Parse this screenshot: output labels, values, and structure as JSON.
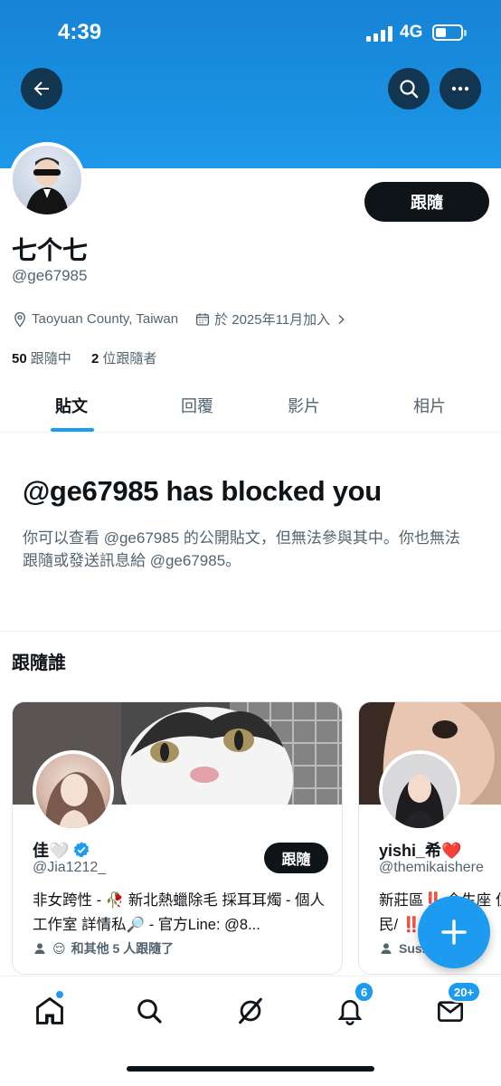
{
  "status_bar": {
    "time": "4:39",
    "network": "4G"
  },
  "profile": {
    "name": "七个七",
    "handle": "@ge67985",
    "location": "Taoyuan County, Taiwan",
    "joined": "於 2025年11月加入",
    "following_count": "50",
    "following_label": "跟隨中",
    "followers_count": "2",
    "followers_label": "位跟隨者",
    "follow_button": "跟隨"
  },
  "tabs": [
    {
      "label": "貼文",
      "active": true
    },
    {
      "label": "回覆",
      "active": false
    },
    {
      "label": "影片",
      "active": false
    },
    {
      "label": "相片",
      "active": false
    }
  ],
  "blocked": {
    "title": "@ge67985 has blocked you",
    "description": "你可以查看 @ge67985 的公開貼文，但無法參與其中。你也無法跟隨或發送訊息給 @ge67985。"
  },
  "who_to_follow": {
    "title": "跟隨誰",
    "cards": [
      {
        "name": "佳🤍",
        "verified": true,
        "handle": "@Jia1212_",
        "follow_label": "跟隨",
        "bio": "非女跨性 - 🥀 新北熱蠟除毛 採耳耳燭 - 個人工作室 詳情私🔎 - 官方Line: @8...",
        "followed_by_emoji": "😌",
        "followed_by": "和其他 5 人跟隨了"
      },
      {
        "name": "yishi_希❤️",
        "verified": false,
        "handle": "@themikaishere",
        "bio": "新莊區‼️ 今生座 住民/ ‼️ ‼️",
        "followed_by": "Sus...n 和"
      }
    ]
  },
  "bottom_nav": {
    "notifications_badge": "6",
    "messages_badge": "20+"
  },
  "colors": {
    "accent": "#1d9bf0",
    "banner": "#1a8fe0",
    "text": "#0f1419",
    "secondary": "#536471"
  },
  "icons": [
    "back-arrow-icon",
    "search-icon",
    "more-icon",
    "location-pin-icon",
    "calendar-icon",
    "verified-badge-icon",
    "home-icon",
    "search-icon",
    "grok-icon",
    "bell-icon",
    "mail-icon",
    "plus-icon"
  ]
}
